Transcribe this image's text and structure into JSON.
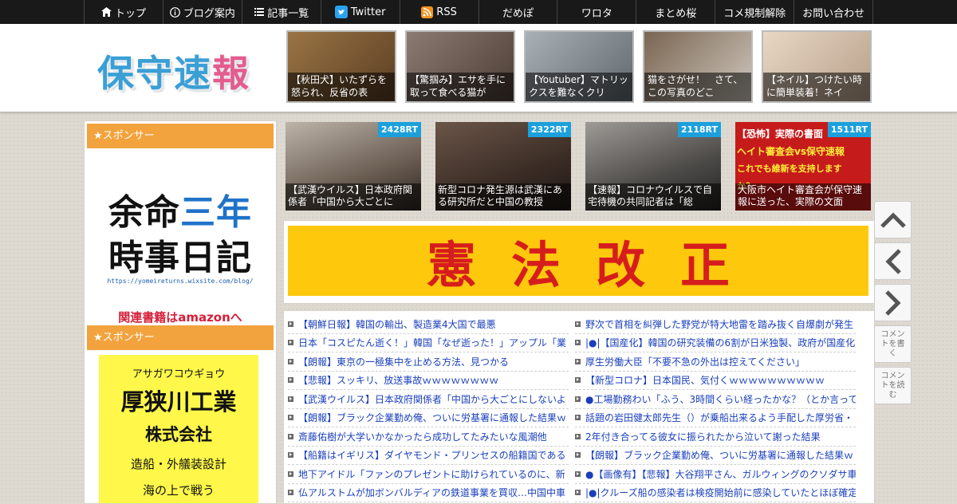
{
  "nav": [
    {
      "label": "トップ",
      "icon": "home-icon"
    },
    {
      "label": "ブログ案内",
      "icon": "info-icon"
    },
    {
      "label": "記事一覧",
      "icon": "list-icon"
    },
    {
      "label": "Twitter",
      "icon": "twitter-icon"
    },
    {
      "label": "RSS",
      "icon": "rss-icon"
    },
    {
      "label": "だめぽ"
    },
    {
      "label": "ワロタ"
    },
    {
      "label": "まとめ桜"
    },
    {
      "label": "コメ規制解除"
    },
    {
      "label": "お問い合わせ"
    }
  ],
  "header": {
    "logo": [
      "保",
      "守",
      "速",
      "報"
    ],
    "thumbs": [
      {
        "caption": "【秋田犬】いたずらを怒られ、反省の表",
        "color": "#7a5a34"
      },
      {
        "caption": "【驚掴み】エサを手に取って食べる猫が",
        "color": "#6b5b52"
      },
      {
        "caption": "【Youtuber】マトリックスを難なくクリ",
        "color": "#8a8f94"
      },
      {
        "caption": "猫をさがせ！　さて、この写真のどこ",
        "color": "#9c8a78"
      },
      {
        "caption": "【ネイル】つけたい時に簡単装着！ネイ",
        "color": "#c9b8a8"
      }
    ]
  },
  "sidebar": {
    "sponsor_label": "★スポンサー",
    "ad1": {
      "line1_a": "余命",
      "line1_b": "三年",
      "line2": "時事日記",
      "url": "https://yomeireturns.wixsite.com/blog/",
      "amazon": "関連書籍はamazonへ"
    },
    "sponsor_label_2": "★スポンサー",
    "ad2": {
      "kana": "アサガワコウギョウ",
      "name": "厚狭川工業",
      "type": "株式会社",
      "business": "造船・外艤装設計",
      "slogan": "海の上で戦う"
    }
  },
  "rt_articles": [
    {
      "rt": "2428RT",
      "caption": "【武漢ウイルス】日本政府関係者「中国から大ごとに",
      "color": "#7c6e62"
    },
    {
      "rt": "2322RT",
      "caption": "新型コロナ発生源は武漢にある研究所だと中国の教授",
      "color": "#4a3c34"
    },
    {
      "rt": "2118RT",
      "caption": "【速報】コロナウイルスで自宅待機の共同記者は「総",
      "color": "#5d5b58"
    },
    {
      "rt": "1511RT",
      "caption": "大阪市ヘイト審査会が保守速報に送った、実際の文面",
      "color": "#c61b1b",
      "overlay_1": "【恐怖】実際の書面",
      "overlay_2": "ヘイト審査会vs保守速報",
      "overlay_3": "これでも維新を支持しますか？"
    }
  ],
  "banner": {
    "text": "憲法改正"
  },
  "links_left": [
    "【朝鮮日報】韓国の輸出、製造業4大国で最悪",
    "日本「コスピたん逝く！」韓国「なぜ逝った！」アップル「業",
    "【朗報】東京の一極集中を止める方法、見つかる",
    "【悲報】スッキリ、放送事故ｗｗｗｗｗｗｗｗ",
    "【武漢ウイルス】日本政府関係者「中国から大ごとにしないよ",
    "【朗報】ブラック企業勤め俺、ついに労基署に通報した結果ｗ",
    "斎藤佑樹が大学いかなかったら成功してたみたいな風潮他",
    "【船籍はイギリス】ダイヤモンド・プリンセスの船籍国である",
    "地下アイドル「ファンのプレゼントに助けられているのに、新",
    "仏アルストムが加ボンバルディアの鉄道事業を買収…中国中車"
  ],
  "links_right": [
    "野次で首相を糾弾した野党が特大地雷を踏み抜く自爆劇が発生",
    "|●|【国産化】韓国の研究装備の6割が日米独製、政府が国産化を",
    "厚生労働大臣「不要不急の外出は控えてください」",
    "【新型コロナ】日本国民、気付くｗｗｗｗｗｗｗｗｗｗ",
    "●工場勤務わい「ふう、3時間くらい経ったかな？（とか言って",
    "話題の岩田健太郎先生（）が乗船出来るよう手配した厚労省・",
    "2年付き合ってる彼女に振られたから泣いて謝った結果",
    "【朗報】ブラック企業勤め俺、ついに労基署に通報した結果ｗ",
    "●【画像有】【悲報】大谷翔平さん、ガルウィングのクソダサ車",
    "|●|クルーズ船の感染者は検疫開始前に感染していたとほぼ確定"
  ],
  "float_buttons": {
    "comment_write": "コメントを書く",
    "comment_read": "コメントを読む"
  }
}
